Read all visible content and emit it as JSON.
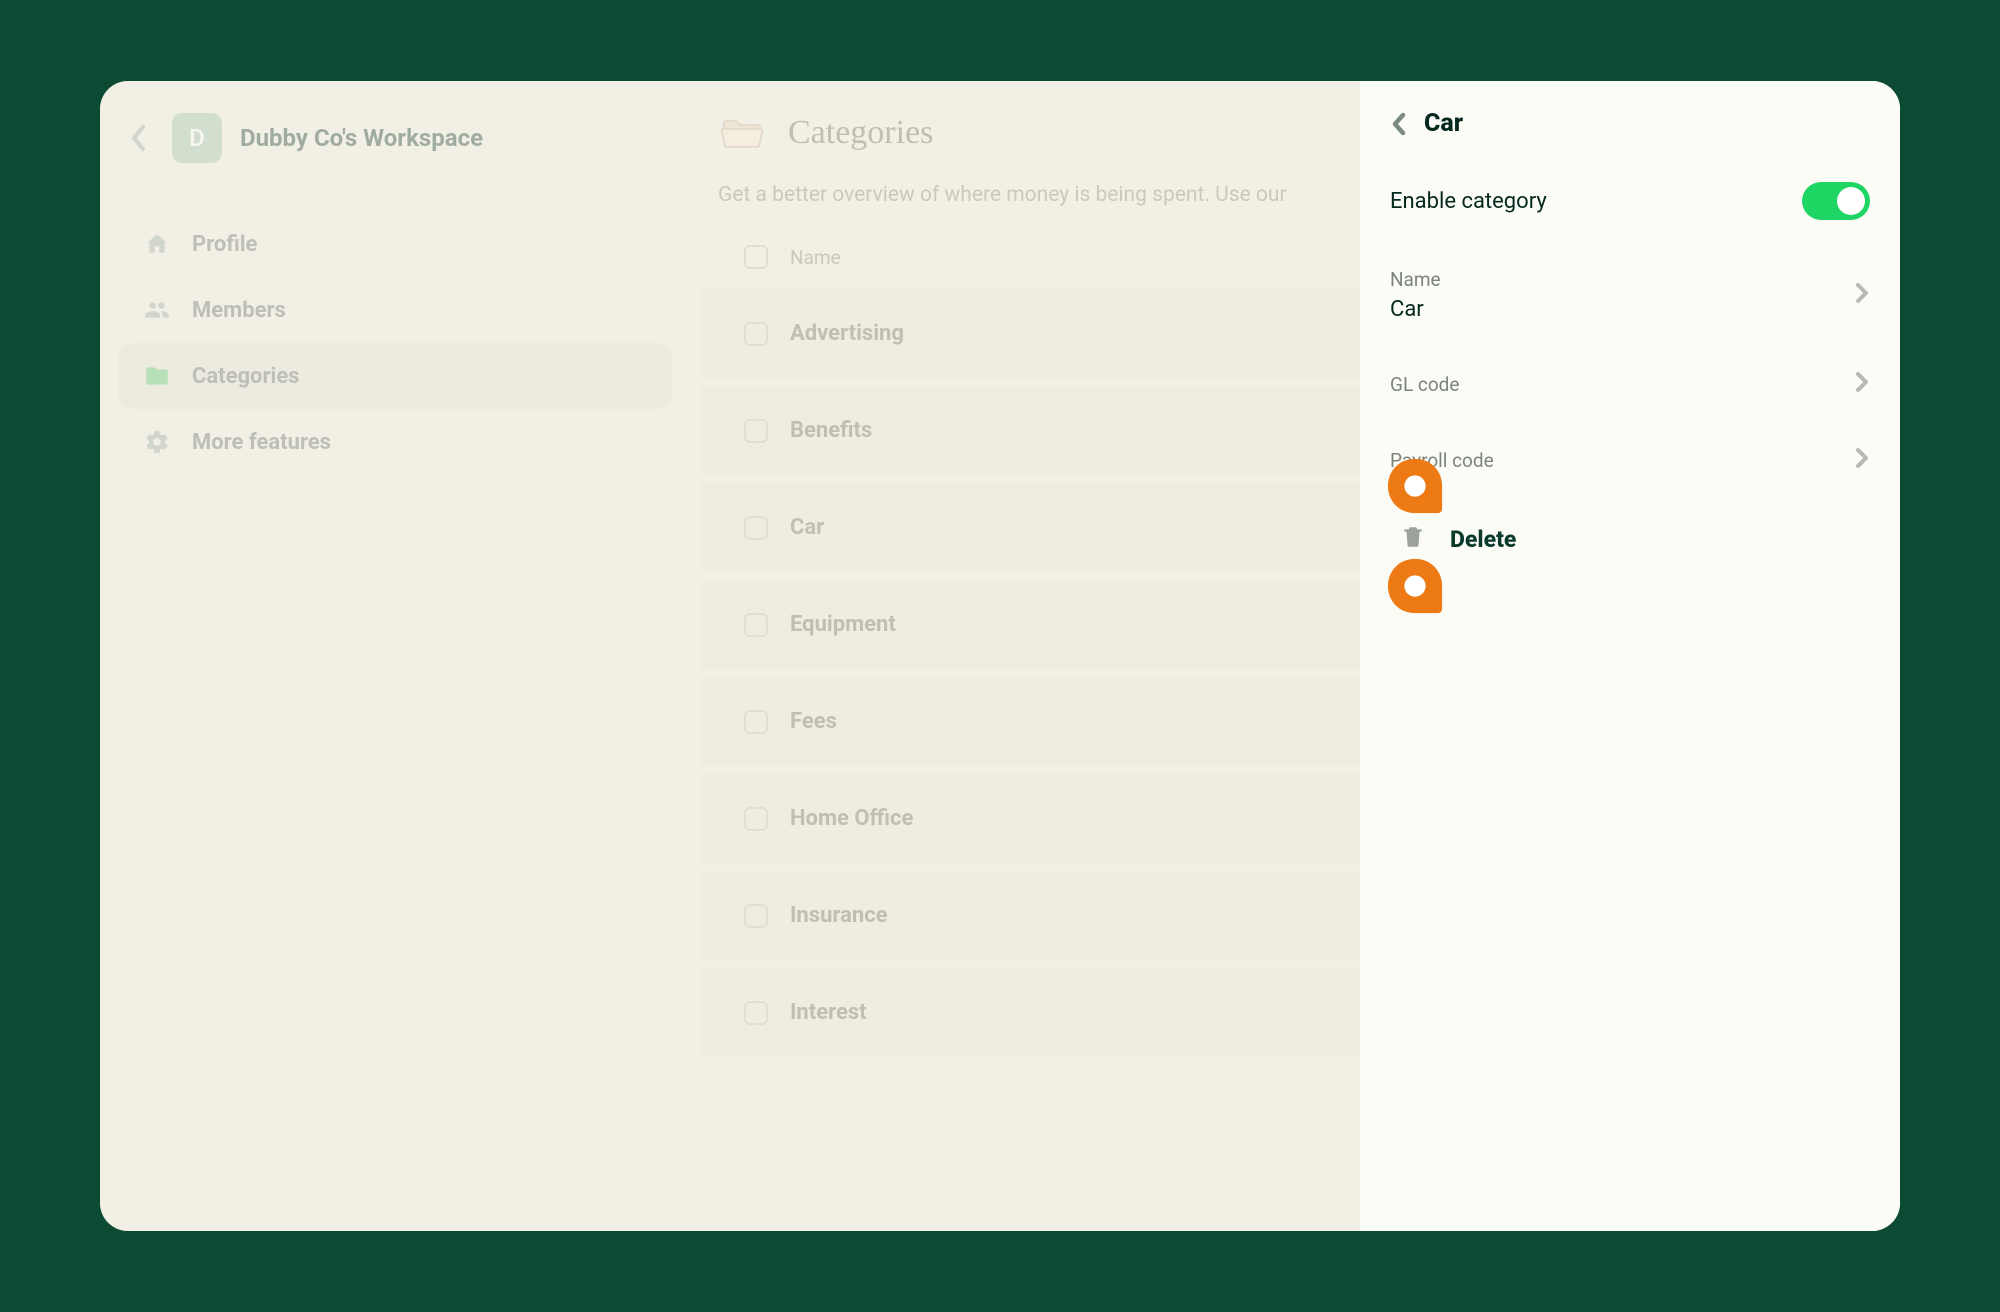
{
  "workspace": {
    "avatar_letter": "D",
    "name": "Dubby Co's Workspace"
  },
  "nav": {
    "profile": "Profile",
    "members": "Members",
    "categories": "Categories",
    "more": "More features"
  },
  "main": {
    "title": "Categories",
    "desc": "Get a better overview of where money is being spent. Use our",
    "name_header": "Name",
    "items": [
      "Advertising",
      "Benefits",
      "Car",
      "Equipment",
      "Fees",
      "Home Office",
      "Insurance",
      "Interest"
    ]
  },
  "panel": {
    "title": "Car",
    "enable_label": "Enable category",
    "name_label": "Name",
    "name_value": "Car",
    "gl_label": "GL code",
    "payroll_label": "Payroll code",
    "delete_label": "Delete"
  }
}
